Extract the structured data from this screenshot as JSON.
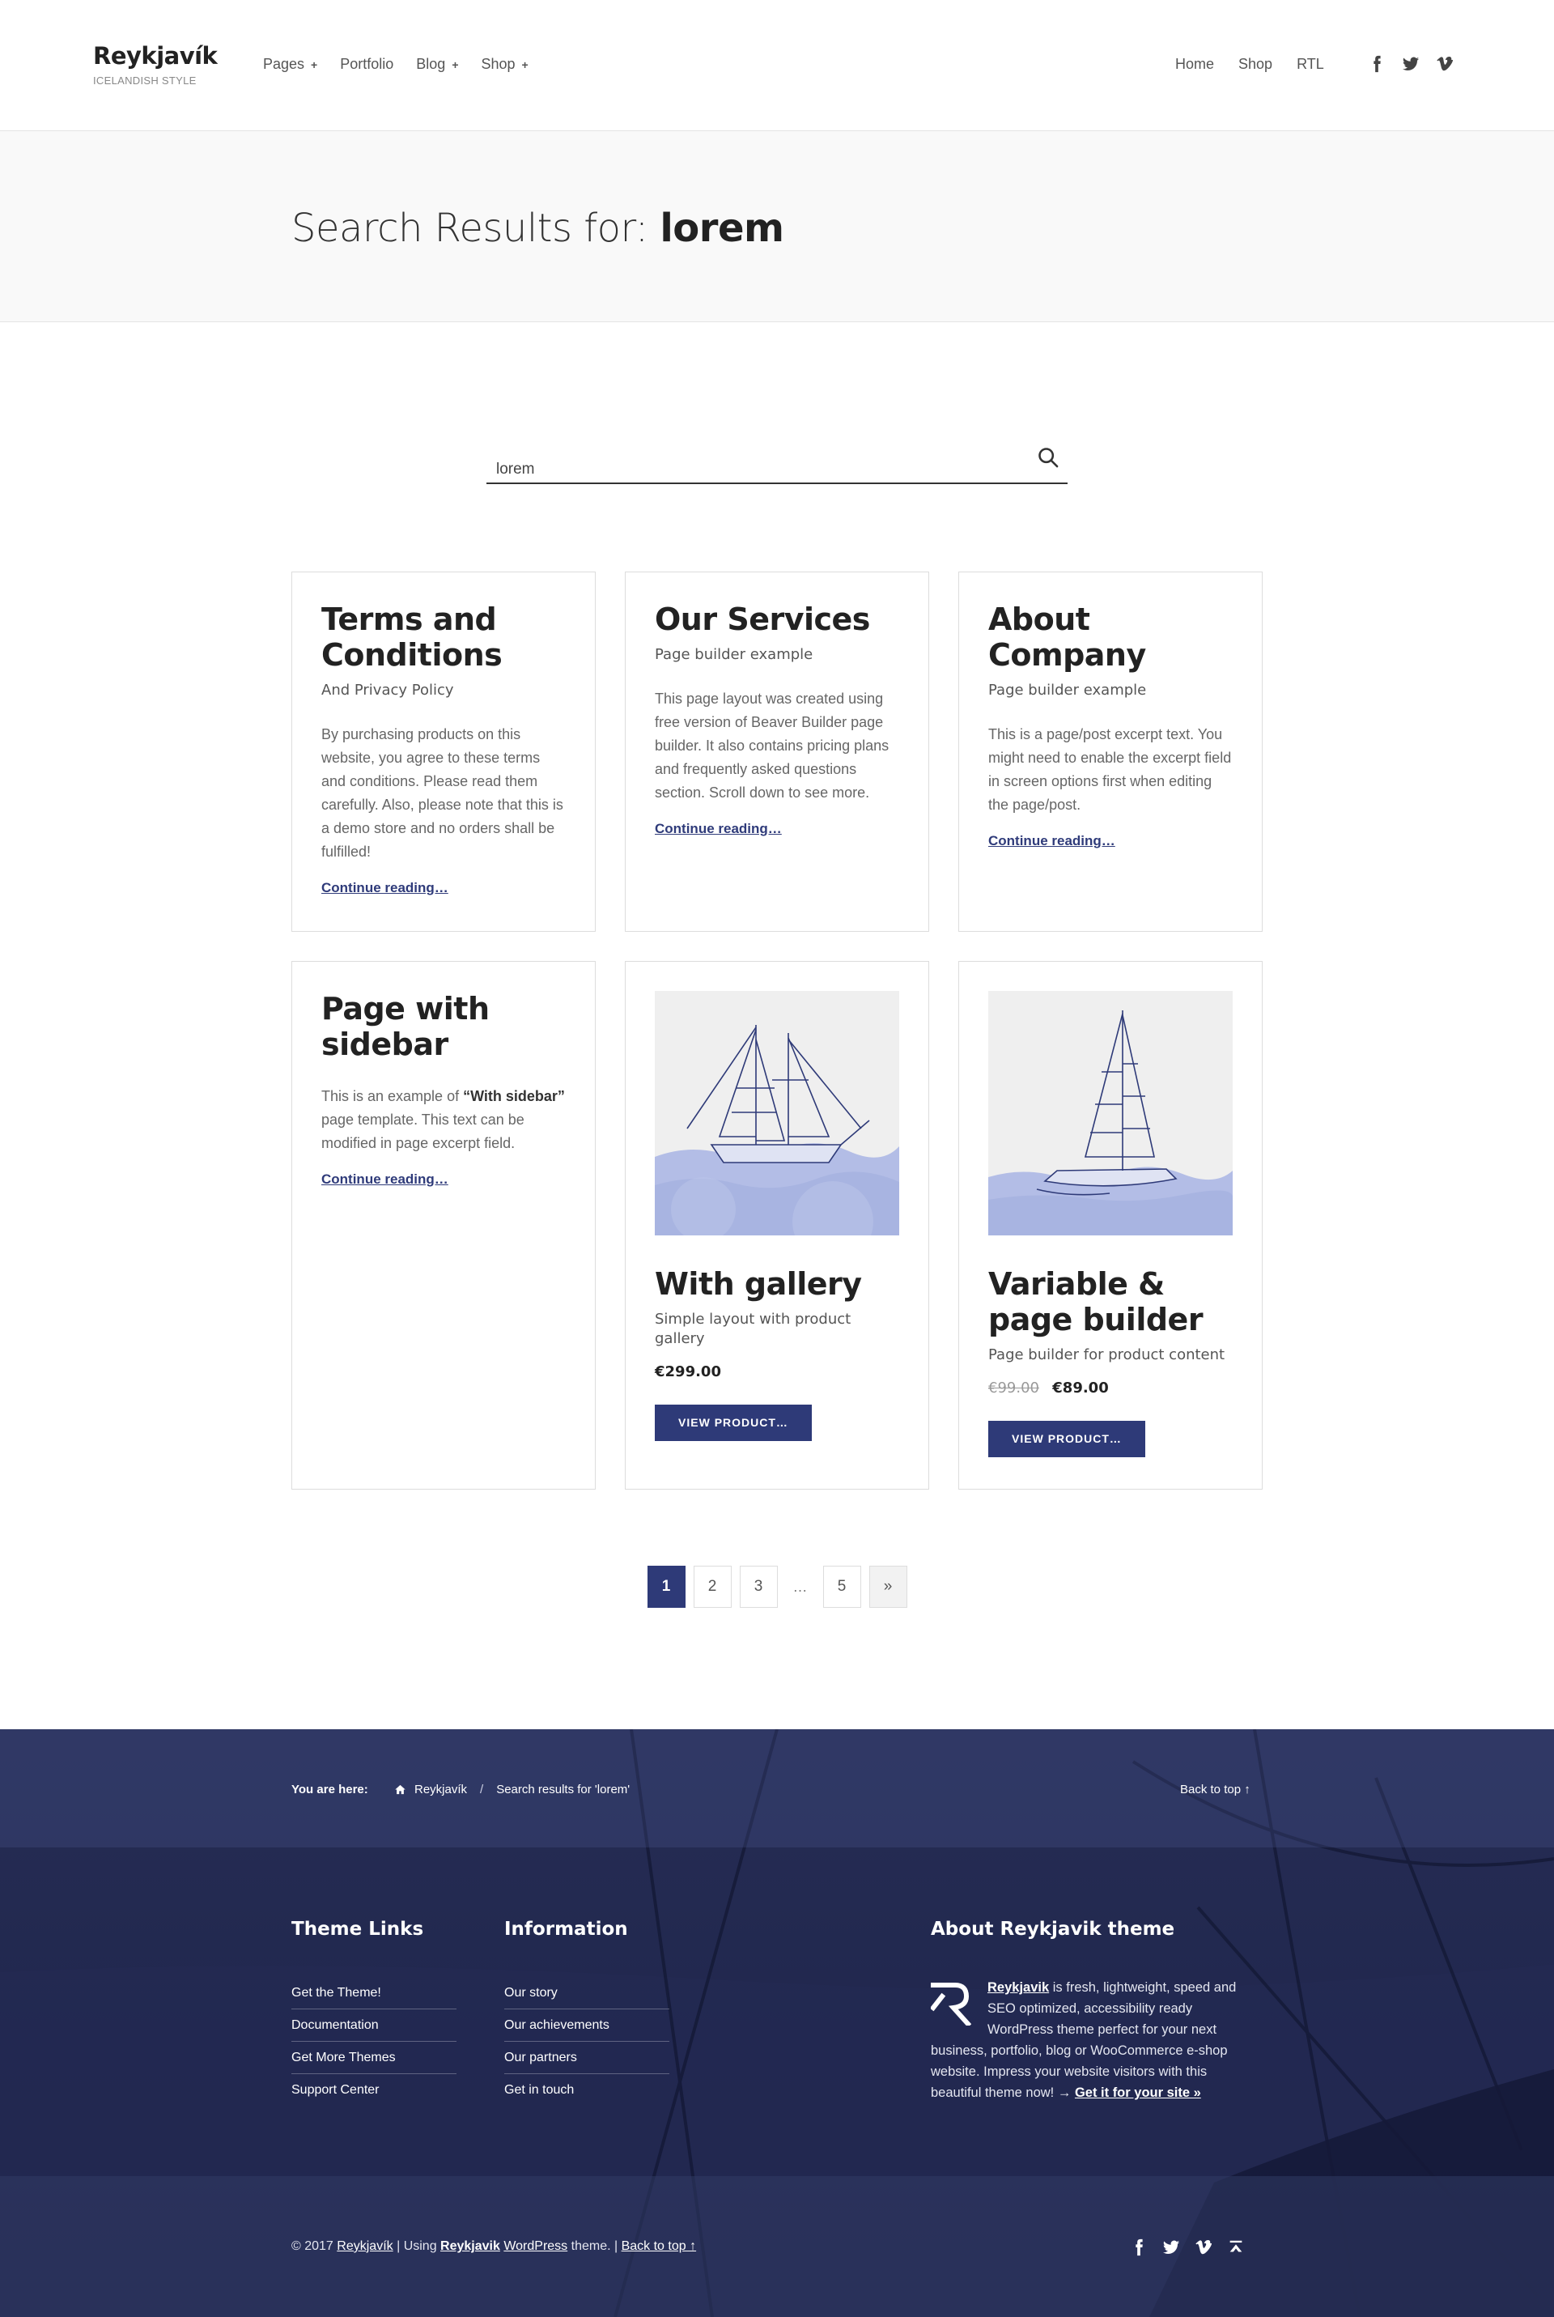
{
  "header": {
    "brand_title": "Reykjavík",
    "brand_tagline": "ICELANDISH STYLE",
    "main_nav": [
      {
        "label": "Pages",
        "has_submenu": true
      },
      {
        "label": "Portfolio",
        "has_submenu": false
      },
      {
        "label": "Blog",
        "has_submenu": true
      },
      {
        "label": "Shop",
        "has_submenu": true
      }
    ],
    "submenu_indicator": "+",
    "secondary_nav": [
      "Home",
      "Shop",
      "RTL"
    ],
    "social_icons": [
      "facebook-icon",
      "twitter-icon",
      "vimeo-icon"
    ]
  },
  "banner": {
    "title_prefix": "Search Results for:",
    "query": "lorem"
  },
  "search": {
    "value": "lorem",
    "icon": "search-icon"
  },
  "results": [
    {
      "title": "Terms and Conditions",
      "subtitle": "And Privacy Policy",
      "excerpt": "By purchasing products on this website, you agree to these terms and conditions. Please read them carefully. Also, please note that this is a demo store and no orders shall be fulfilled!",
      "link": "Continue reading…"
    },
    {
      "title": "Our Services",
      "subtitle": "Page builder example",
      "excerpt": "This page layout was created using free version of Beaver Builder page builder. It also contains pricing plans and frequently asked questions section. Scroll down to see more.",
      "link": "Continue reading…"
    },
    {
      "title": "About Company",
      "subtitle": "Page builder example",
      "excerpt": "This is a page/post excerpt text. You might need to enable the excerpt field in screen options first when editing the page/post.",
      "link": "Continue reading…"
    },
    {
      "title": "Page with sidebar",
      "excerpt_before": "This is an example of ",
      "excerpt_strong": "“With sidebar”",
      "excerpt_after": " page template. This text can be modified in page excerpt field.",
      "link": "Continue reading…"
    },
    {
      "title": "With gallery",
      "subtitle": "Simple layout with product gallery",
      "price": "€299.00",
      "button": "VIEW PRODUCT…"
    },
    {
      "title": "Variable & page builder",
      "subtitle": "Page builder for product content",
      "old_price": "€99.00",
      "price": "€89.00",
      "button": "VIEW PRODUCT…"
    }
  ],
  "pagination": {
    "pages": [
      "1",
      "2",
      "3"
    ],
    "dots": "…",
    "last": "5",
    "next": "»",
    "current": "1"
  },
  "footer": {
    "breadcrumb_label": "You are here:",
    "breadcrumb_home": "Reykjavík",
    "breadcrumb_sep": "/",
    "breadcrumb_current": "Search results for 'lorem'",
    "back_to_top": "Back to top ↑",
    "theme_links_title": "Theme Links",
    "theme_links": [
      "Get the Theme!",
      "Documentation",
      "Get More Themes",
      "Support Center"
    ],
    "information_title": "Information",
    "information_links": [
      "Our story",
      "Our achievements",
      "Our partners",
      "Get in touch"
    ],
    "about_title": "About Reykjavik theme",
    "about_link": "Reykjavik",
    "about_text": " is fresh, lightweight, speed and SEO optimized, accessibility ready WordPress theme perfect for your next business, portfolio, blog or WooCommerce e-shop website. Impress your website visitors with this beautiful theme now! → ",
    "about_cta": "Get it for your site »",
    "copyright_prefix": "© 2017 ",
    "copyright_site": "Reykjavík",
    "copyright_using": " | Using ",
    "copyright_theme": "Reykjavik",
    "copyright_space": " ",
    "copyright_wp": "WordPress",
    "copyright_suffix": " theme. | ",
    "copyright_back": "Back to top ↑",
    "social_icons": [
      "facebook-icon",
      "twitter-icon",
      "vimeo-icon",
      "back-to-top-icon"
    ]
  },
  "colors": {
    "accent": "#2e3a78",
    "footer_bg": "#1d2449",
    "heading": "#222222"
  }
}
